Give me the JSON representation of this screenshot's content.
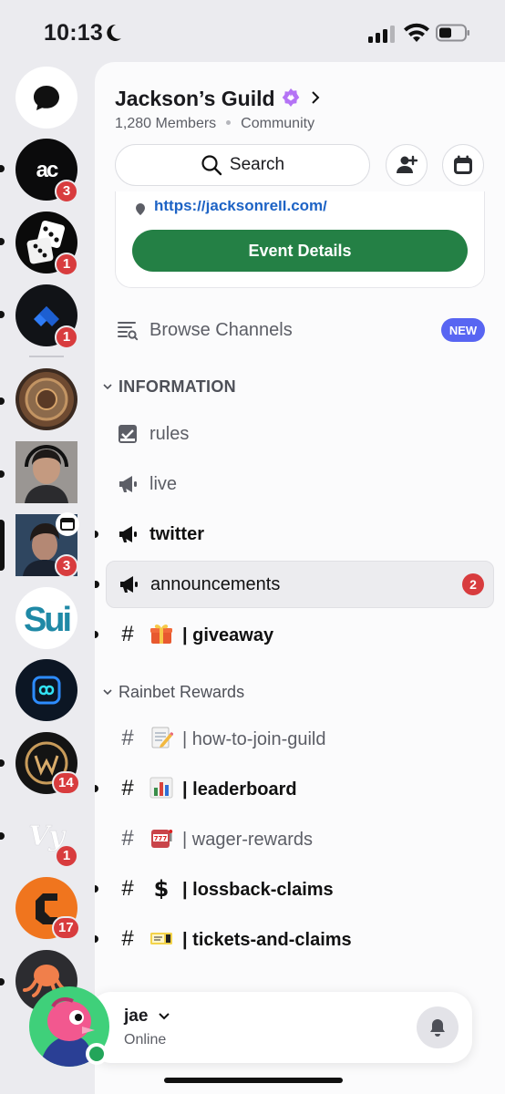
{
  "status_bar": {
    "time": "10:13"
  },
  "servers": [
    {
      "name": "server-ac",
      "badge": "3"
    },
    {
      "name": "server-dice",
      "badge": "1"
    },
    {
      "name": "server-blue-logo",
      "badge": "1"
    },
    {
      "name": "server-bronze-emblem",
      "badge": ""
    },
    {
      "name": "server-portrait",
      "badge": ""
    },
    {
      "name": "server-active",
      "badge": "3"
    },
    {
      "name": "server-sui",
      "badge": ""
    },
    {
      "name": "server-link-logo",
      "badge": ""
    },
    {
      "name": "server-gold-crest",
      "badge": "14"
    },
    {
      "name": "server-script-logo",
      "badge": "1"
    },
    {
      "name": "server-orange-logo",
      "badge": "17"
    },
    {
      "name": "server-octopus",
      "badge": ""
    }
  ],
  "guild": {
    "title": "Jackson’s Guild",
    "members": "1,280 Members",
    "type": "Community",
    "search_label": "Search"
  },
  "event": {
    "link": "https://jacksonrell.com/",
    "button_label": "Event Details"
  },
  "browse": {
    "label": "Browse Channels",
    "badge": "NEW"
  },
  "categories": {
    "information": "INFORMATION",
    "rainbet": "Rainbet Rewards"
  },
  "channels": {
    "rules": "rules",
    "live": "live",
    "twitter": "twitter",
    "announcements": "announcements",
    "announcements_mentions": "2",
    "giveaway": "| giveaway",
    "how_to_join": "| how-to-join-guild",
    "leaderboard": "| leaderboard",
    "wager_rewards": "| wager-rewards",
    "lossback_claims": "| lossback-claims",
    "tickets_and_claims": "| tickets-and-claims"
  },
  "user": {
    "name": "jae",
    "status": "Online"
  },
  "colors": {
    "accent": "#5865f2",
    "green": "#248045",
    "danger": "#d83c3e",
    "online": "#23a55a"
  }
}
